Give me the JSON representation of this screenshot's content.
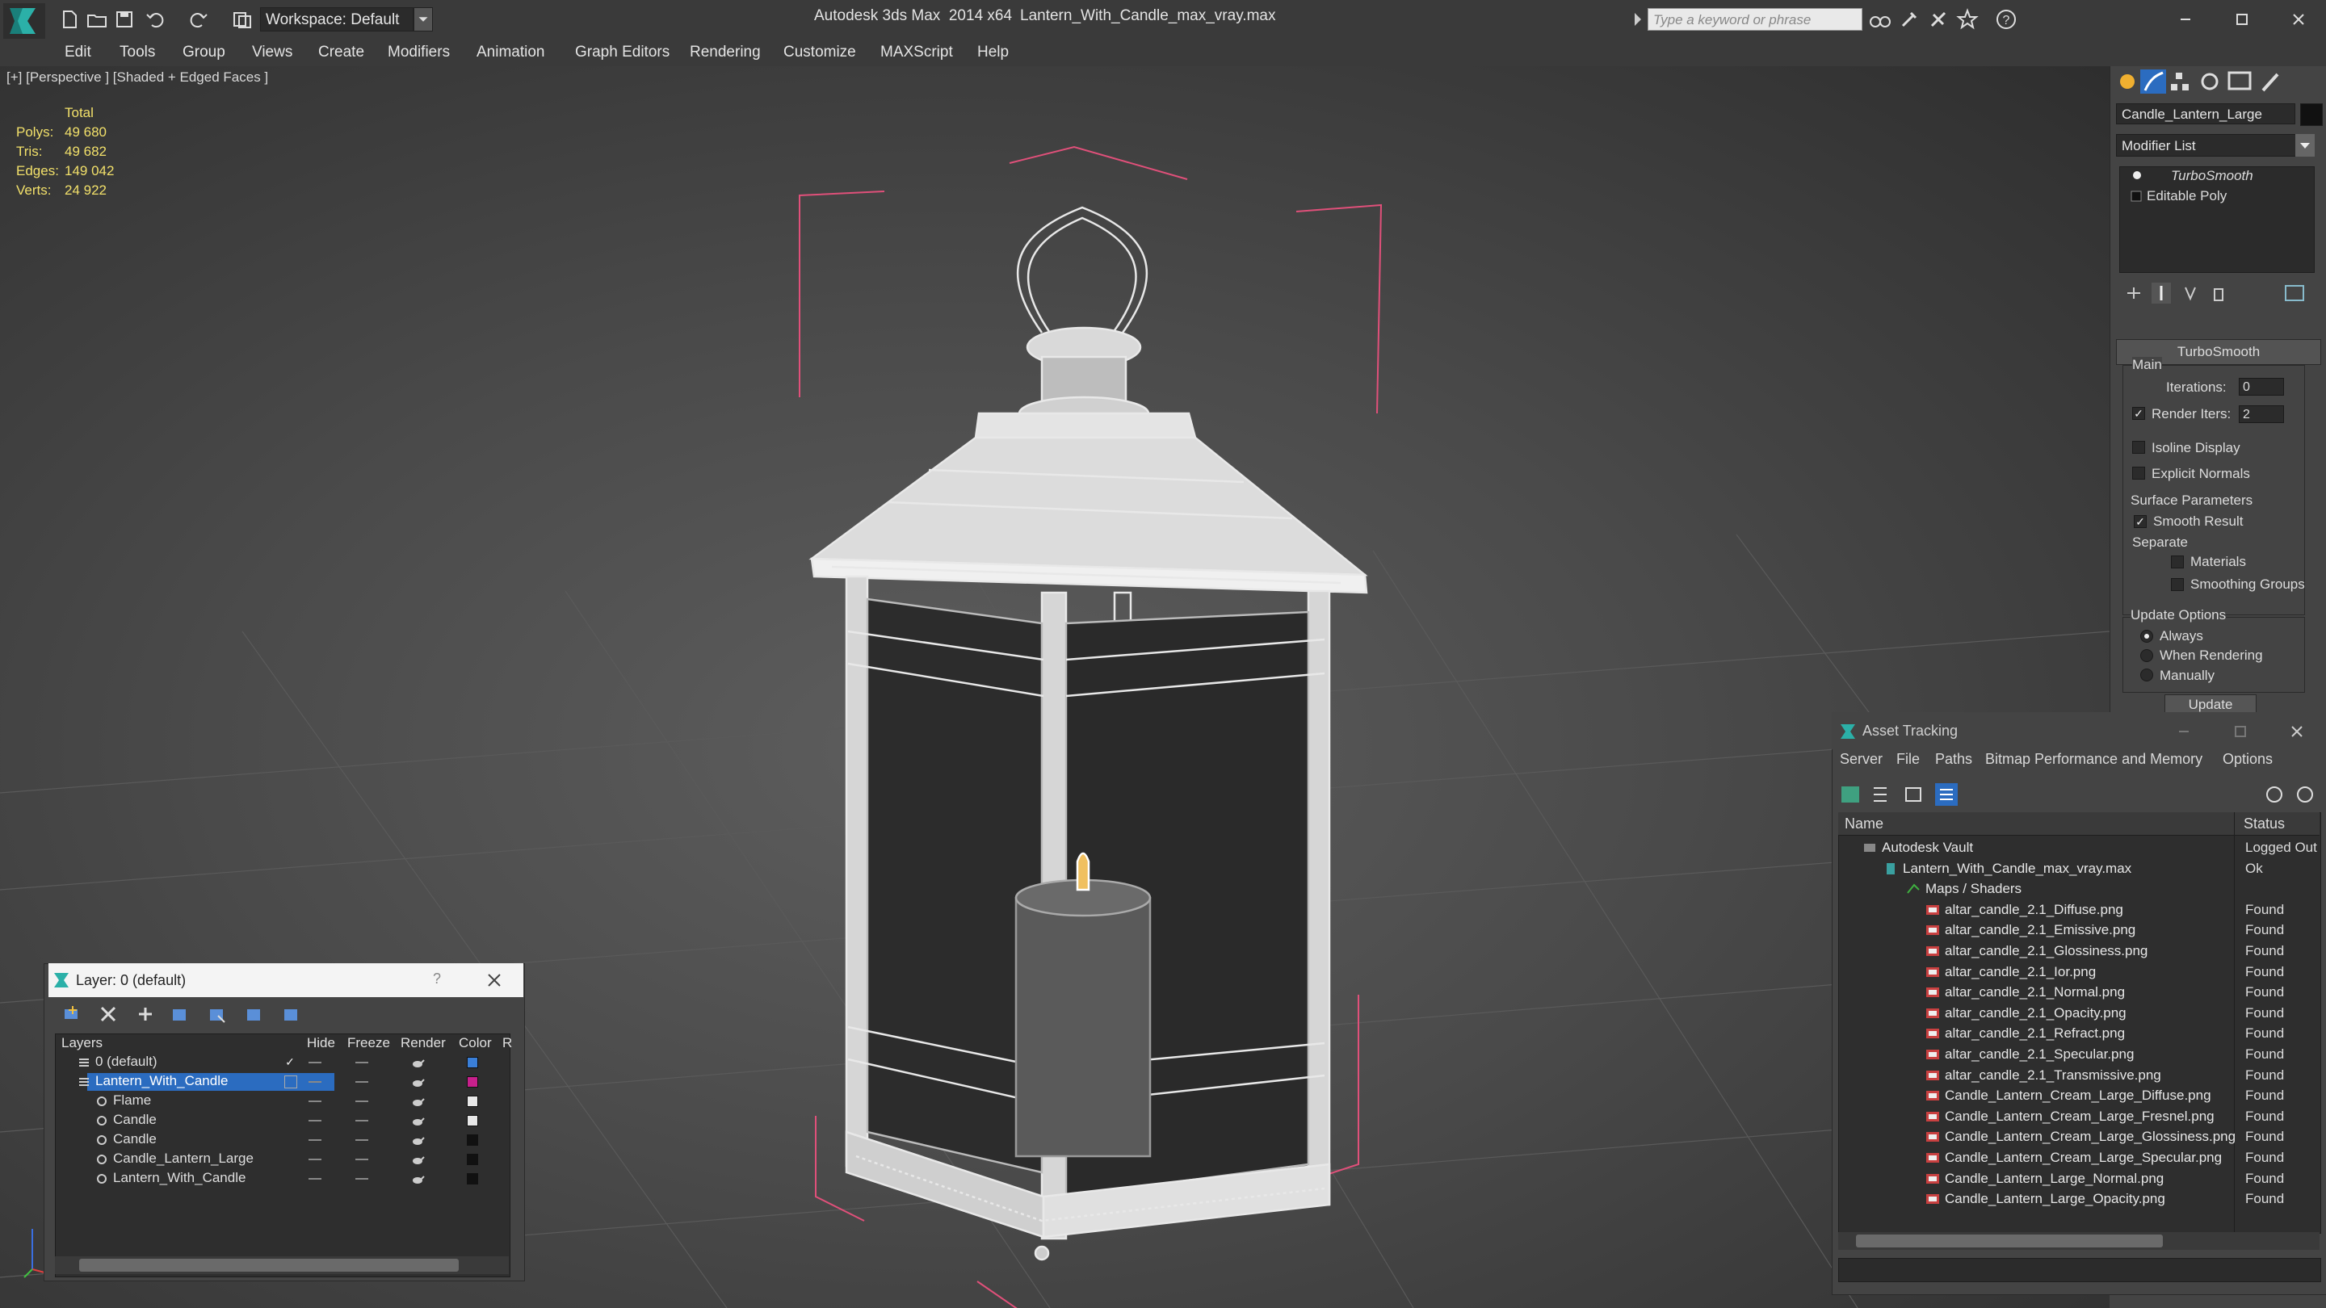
{
  "titlebar": {
    "workspace": "Workspace: Default",
    "app_title": "Autodesk 3ds Max  2014 x64",
    "file_title": "Lantern_With_Candle_max_vray.max",
    "search_placeholder": "Type a keyword or phrase"
  },
  "menu": [
    "Edit",
    "Tools",
    "Group",
    "Views",
    "Create",
    "Modifiers",
    "Animation",
    "Graph Editors",
    "Rendering",
    "Customize",
    "MAXScript",
    "Help"
  ],
  "viewport": {
    "label": "[+] [Perspective ] [Shaded + Edged Faces ]",
    "stats": {
      "total_label": "Total",
      "polys_label": "Polys:",
      "polys": "49 680",
      "tris_label": "Tris:",
      "tris": "49 682",
      "edges_label": "Edges:",
      "edges": "149 042",
      "verts_label": "Verts:",
      "verts": "24 922"
    }
  },
  "command_panel": {
    "object_name": "Candle_Lantern_Large",
    "modifier_list": "Modifier List",
    "stack": [
      "TurboSmooth",
      "Editable Poly"
    ],
    "rollout_title": "TurboSmooth",
    "main_label": "Main",
    "iterations_label": "Iterations:",
    "iterations": "0",
    "render_iters_label": "Render Iters:",
    "render_iters": "2",
    "isoline_display": "Isoline Display",
    "explicit_normals": "Explicit Normals",
    "surface_parameters": "Surface Parameters",
    "smooth_result": "Smooth Result",
    "separate": "Separate",
    "materials": "Materials",
    "smoothing_groups": "Smoothing Groups",
    "update_options": "Update Options",
    "always": "Always",
    "when_rendering": "When Rendering",
    "manually": "Manually",
    "update_button": "Update"
  },
  "layer_dialog": {
    "title": "Layer: 0 (default)",
    "help": "?",
    "columns": [
      "Layers",
      "Hide",
      "Freeze",
      "Render",
      "Color",
      "R"
    ],
    "rows": [
      {
        "name": "0 (default)",
        "indent": 1,
        "color": "#3a7fd8",
        "selected": false,
        "layer": true,
        "active": true
      },
      {
        "name": "Lantern_With_Candle",
        "indent": 1,
        "color": "#c8208c",
        "selected": true,
        "layer": true,
        "active": false
      },
      {
        "name": "Flame",
        "indent": 2,
        "color": "#e8e8e8",
        "selected": false,
        "layer": false,
        "active": false
      },
      {
        "name": "Candle",
        "indent": 2,
        "color": "#e8e8e8",
        "selected": false,
        "layer": false,
        "active": false
      },
      {
        "name": "Candle",
        "indent": 2,
        "color": "#111111",
        "selected": false,
        "layer": false,
        "active": false
      },
      {
        "name": "Candle_Lantern_Large",
        "indent": 2,
        "color": "#111111",
        "selected": false,
        "layer": false,
        "active": false
      },
      {
        "name": "Lantern_With_Candle",
        "indent": 2,
        "color": "#111111",
        "selected": false,
        "layer": false,
        "active": false
      }
    ]
  },
  "asset_tracking": {
    "title": "Asset Tracking",
    "menu": [
      "Server",
      "File",
      "Paths",
      "Bitmap Performance and Memory",
      "Options"
    ],
    "columns": [
      "Name",
      "Status"
    ],
    "rows": [
      {
        "name": "Autodesk Vault",
        "status": "Logged Out",
        "level": 0,
        "kind": "vault"
      },
      {
        "name": "Lantern_With_Candle_max_vray.max",
        "status": "Ok",
        "level": 1,
        "kind": "max"
      },
      {
        "name": "Maps / Shaders",
        "status": "",
        "level": 2,
        "kind": "folder"
      },
      {
        "name": "altar_candle_2.1_Diffuse.png",
        "status": "Found",
        "level": 3,
        "kind": "png"
      },
      {
        "name": "altar_candle_2.1_Emissive.png",
        "status": "Found",
        "level": 3,
        "kind": "png"
      },
      {
        "name": "altar_candle_2.1_Glossiness.png",
        "status": "Found",
        "level": 3,
        "kind": "png"
      },
      {
        "name": "altar_candle_2.1_Ior.png",
        "status": "Found",
        "level": 3,
        "kind": "png"
      },
      {
        "name": "altar_candle_2.1_Normal.png",
        "status": "Found",
        "level": 3,
        "kind": "png"
      },
      {
        "name": "altar_candle_2.1_Opacity.png",
        "status": "Found",
        "level": 3,
        "kind": "png"
      },
      {
        "name": "altar_candle_2.1_Refract.png",
        "status": "Found",
        "level": 3,
        "kind": "png"
      },
      {
        "name": "altar_candle_2.1_Specular.png",
        "status": "Found",
        "level": 3,
        "kind": "png"
      },
      {
        "name": "altar_candle_2.1_Transmissive.png",
        "status": "Found",
        "level": 3,
        "kind": "png"
      },
      {
        "name": "Candle_Lantern_Cream_Large_Diffuse.png",
        "status": "Found",
        "level": 3,
        "kind": "png"
      },
      {
        "name": "Candle_Lantern_Cream_Large_Fresnel.png",
        "status": "Found",
        "level": 3,
        "kind": "png"
      },
      {
        "name": "Candle_Lantern_Cream_Large_Glossiness.png",
        "status": "Found",
        "level": 3,
        "kind": "png"
      },
      {
        "name": "Candle_Lantern_Cream_Large_Specular.png",
        "status": "Found",
        "level": 3,
        "kind": "png"
      },
      {
        "name": "Candle_Lantern_Large_Normal.png",
        "status": "Found",
        "level": 3,
        "kind": "png"
      },
      {
        "name": "Candle_Lantern_Large_Opacity.png",
        "status": "Found",
        "level": 3,
        "kind": "png"
      }
    ]
  }
}
